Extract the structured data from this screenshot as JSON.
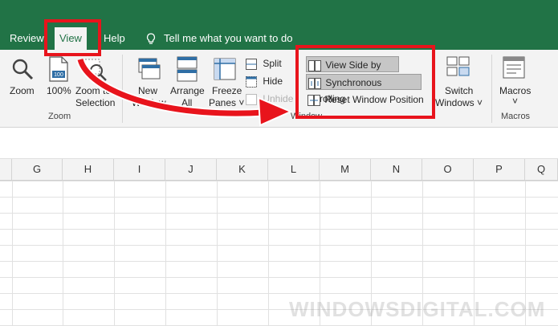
{
  "tabs": [
    {
      "label": "Review"
    },
    {
      "label": "View"
    },
    {
      "label": "Help"
    }
  ],
  "tell_me": "Tell me what you want to do",
  "zoom_group": {
    "zoom": "Zoom",
    "hundred": "100%",
    "zoom_to_selection_1": "Zoom to",
    "zoom_to_selection_2": "Selection",
    "label": "Zoom"
  },
  "window_group": {
    "new_window_1": "New",
    "new_window_2": "Window",
    "arrange_1": "Arrange",
    "arrange_2": "All",
    "freeze_1": "Freeze",
    "freeze_2": "Panes ˅",
    "split": "Split",
    "hide": "Hide",
    "unhide": "Unhide",
    "view_side_by_side": "View Side by Side",
    "sync_scrolling": "Synchronous Scrolling",
    "reset_position": "Reset Window Position",
    "switch_1": "Switch",
    "switch_2": "Windows ˅",
    "label": "Window"
  },
  "macros_group": {
    "macros_1": "Macros",
    "macros_2": "˅",
    "label": "Macros"
  },
  "columns": [
    "G",
    "H",
    "I",
    "J",
    "K",
    "L",
    "M",
    "N",
    "O",
    "P",
    "Q"
  ],
  "watermark": "WINDOWSDIGITAL.COM",
  "colors": {
    "accent": "#217346",
    "highlight": "#e8141c"
  }
}
